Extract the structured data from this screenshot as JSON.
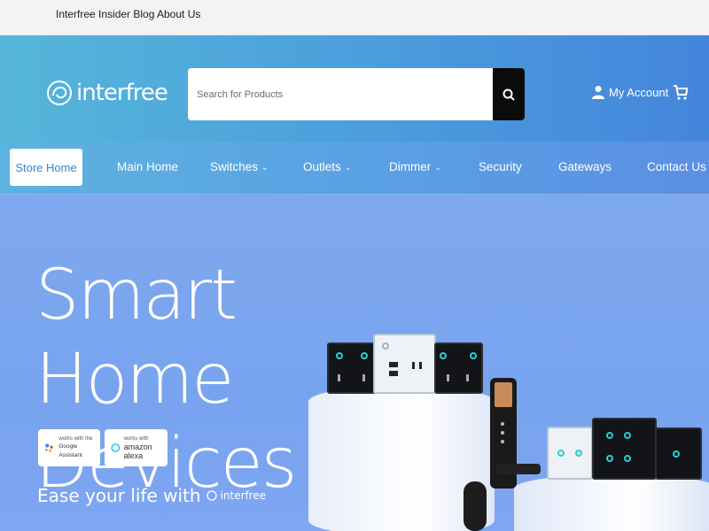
{
  "topbar": {
    "links": [
      "Interfree Insider Blog",
      "About Us"
    ]
  },
  "header": {
    "logo_text": "interfree",
    "search_placeholder": "Search for Products",
    "account_label": "My Account"
  },
  "nav": {
    "items": [
      {
        "label": "Store Home",
        "active": true
      },
      {
        "label": "Main Home"
      },
      {
        "label": "Switches",
        "dropdown": true
      },
      {
        "label": "Outlets",
        "dropdown": true
      },
      {
        "label": "Dimmer",
        "dropdown": true
      },
      {
        "label": "Security"
      },
      {
        "label": "Gateways"
      },
      {
        "label": "Contact Us"
      }
    ]
  },
  "hero": {
    "title_line1": "Smart Home",
    "title_line2": "Devices",
    "badge_google_small": "works with the",
    "badge_google_big": "Google Assistant",
    "badge_alexa_small": "works with",
    "badge_alexa_big": "amazon alexa",
    "tagline": "Ease your life with",
    "tagline_brand": "interfree"
  },
  "colors": {
    "header_gradient_start": "#55b6da",
    "header_gradient_end": "#4485dc",
    "hero_bg": "#7aa6ee",
    "active_nav_text": "#2f86d6",
    "accent_teal": "#2ad0d6"
  },
  "icons": [
    "search-icon",
    "user-icon",
    "cart-icon",
    "chevron-down-icon",
    "interfree-logo-icon"
  ]
}
